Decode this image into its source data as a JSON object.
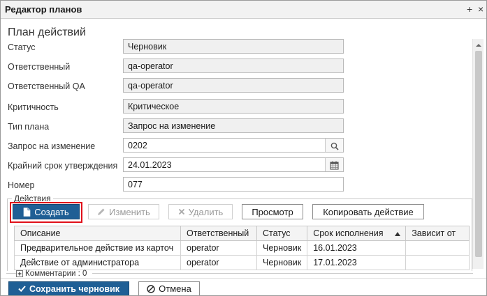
{
  "window": {
    "title": "Редактор планов",
    "pin_glyph": "+",
    "close_glyph": "×"
  },
  "form": {
    "section_title": "План действий",
    "fields": [
      {
        "label": "Статус",
        "value": "Черновик"
      },
      {
        "label": "Ответственный",
        "value": "qa-operator"
      },
      {
        "label": "Ответственный QA",
        "value": "qa-operator"
      },
      {
        "label": "Критичность",
        "value": "Критическое"
      },
      {
        "label": "Тип плана",
        "value": "Запрос на изменение"
      },
      {
        "label": "Запрос на изменение",
        "value": "0202"
      },
      {
        "label": "Крайний срок утверждения",
        "value": "24.01.2023"
      },
      {
        "label": "Номер",
        "value": "077"
      }
    ]
  },
  "actions": {
    "legend": "Действия",
    "toolbar": {
      "create": "Создать",
      "edit": "Изменить",
      "delete": "Удалить",
      "view": "Просмотр",
      "copy": "Копировать действие"
    },
    "table": {
      "columns": [
        "Описание",
        "Ответственный",
        "Статус",
        "Срок исполнения",
        "Зависит от"
      ],
      "rows": [
        [
          "Предварительное действие из карточ",
          "operator",
          "Черновик",
          "16.01.2023",
          ""
        ],
        [
          "Действие от администратора",
          "operator",
          "Черновик",
          "17.01.2023",
          ""
        ]
      ]
    }
  },
  "comments": {
    "label": "Комментарии : 0"
  },
  "footer": {
    "save_draft": "Сохранить черновик",
    "cancel": "Отмена"
  },
  "icons": {
    "search": "search-icon",
    "calendar": "calendar-icon",
    "document": "document-icon",
    "pencil": "pencil-icon",
    "cross": "cross-icon",
    "save": "save-icon",
    "cancel": "cancel-icon",
    "sort": "sort-asc-icon"
  },
  "colors": {
    "primary": "#1f5f95",
    "highlight": "#e0101a"
  }
}
